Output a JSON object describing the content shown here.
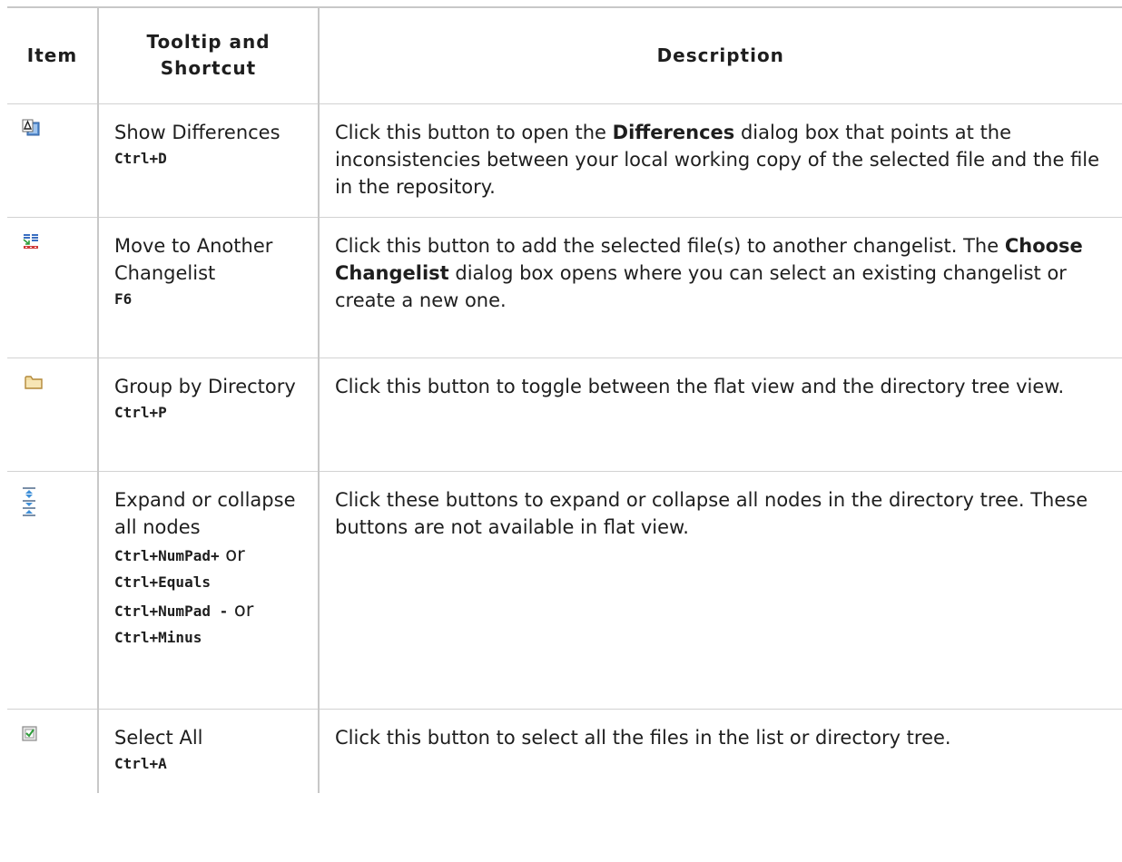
{
  "header": {
    "item": "Item",
    "tooltip": "Tooltip and Shortcut",
    "description": "Description"
  },
  "rows": [
    {
      "icon": "show-diff-icon",
      "tooltip": "Show Differences",
      "shortcut": "Ctrl+D",
      "desc_a": "Click this button to open the ",
      "desc_b": "Differences",
      "desc_c": " dialog box that points at the inconsistencies between your local working copy of the selected file and the file in the repository."
    },
    {
      "icon": "move-changelist-icon",
      "tooltip": "Move to Another Changelist",
      "shortcut": "F6",
      "desc_a": "Click this button to add the selected file(s) to another changelist. The ",
      "desc_b": "Choose Changelist",
      "desc_c": " dialog box opens where you can select an existing changelist or create a new one."
    },
    {
      "icon": "folder-icon",
      "tooltip": "Group by Directory",
      "shortcut": "Ctrl+P",
      "desc": "Click this button to toggle between the flat view and the directory tree view."
    },
    {
      "icon": "expand-collapse-icon",
      "tooltip": "Expand or collapse all nodes",
      "shortcut_1": "Ctrl+NumPad+",
      "or_1": " or",
      "shortcut_2": "Ctrl+Equals",
      "shortcut_3": "Ctrl+NumPad -",
      "or_2": " or",
      "shortcut_4": "Ctrl+Minus",
      "desc": "Click these buttons to expand or collapse all nodes in the directory tree. These buttons are not available in flat view."
    },
    {
      "icon": "select-all-icon",
      "tooltip": "Select All",
      "shortcut": "Ctrl+A",
      "desc": "Click this button to select all the files in the list or directory tree."
    }
  ]
}
